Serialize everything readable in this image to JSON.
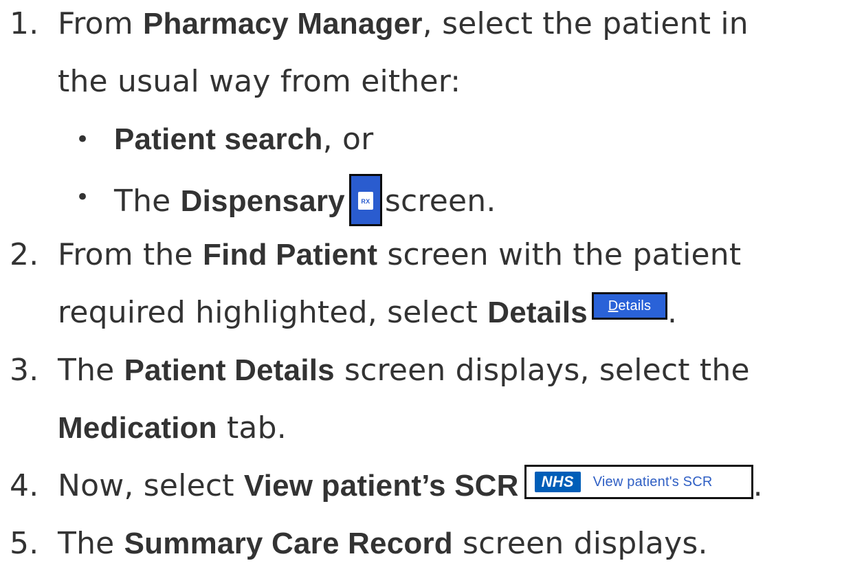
{
  "steps": {
    "s1": {
      "num": "1.",
      "pre": "From ",
      "bold": "Pharmacy Manager",
      "post": ", select the patient in",
      "cont": "the usual way from either:"
    },
    "bullets": {
      "b1": {
        "bullet": "•",
        "bold": "Patient search",
        "post": ", or"
      },
      "b2": {
        "bullet": "•",
        "pre": "The ",
        "bold": "Dispensary",
        "icon": "rx-document-icon",
        "icon_text": "RX",
        "post": "screen."
      }
    },
    "s2": {
      "num": "2.",
      "pre": "From the ",
      "bold": "Find Patient",
      "post": " screen with the patient",
      "cont_pre": "required highlighted, select ",
      "cont_bold": "Details",
      "button_ul": "D",
      "button_rest": "etails",
      "end": "."
    },
    "s3": {
      "num": "3.",
      "pre": "The ",
      "bold": "Patient Details",
      "post": " screen displays, select the",
      "cont_bold": "Medication",
      "cont_post": " tab."
    },
    "s4": {
      "num": "4.",
      "pre": "Now, select ",
      "bold": "View patient’s SCR",
      "nhs_logo": "NHS",
      "button_label": "View patient's SCR",
      "end": "."
    },
    "s5": {
      "num": "5.",
      "pre": "The ",
      "bold": "Summary Care Record",
      "post": " screen displays."
    }
  },
  "colors": {
    "text": "#333333",
    "dispensary_icon": "#2a5ccf",
    "details_button": "#2a62d8",
    "nhs_blue": "#005eb8",
    "scr_label": "#2f5fc4"
  }
}
